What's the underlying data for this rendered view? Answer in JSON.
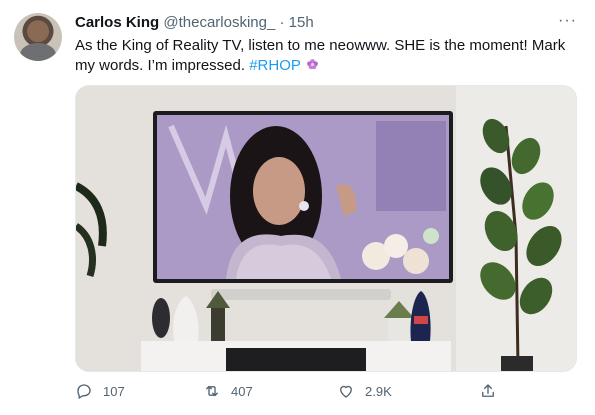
{
  "tweet": {
    "display_name": "Carlos King",
    "handle": "@thecarlosking_",
    "separator": "·",
    "time": "15h",
    "more_label": "···",
    "text_main": "As the King of Reality TV, listen to me neowww. SHE is the moment! Mark my words. I’m impressed.",
    "hashtag": "#RHOP",
    "emoji": "flower-emoji",
    "media": {
      "icon": "tv-photo"
    },
    "actions": {
      "reply_count": "107",
      "retweet_count": "407",
      "like_count": "2.9K"
    }
  },
  "colors": {
    "accent": "#1d9bf0",
    "secondary_text": "#536471",
    "primary_text": "#0f1419"
  }
}
